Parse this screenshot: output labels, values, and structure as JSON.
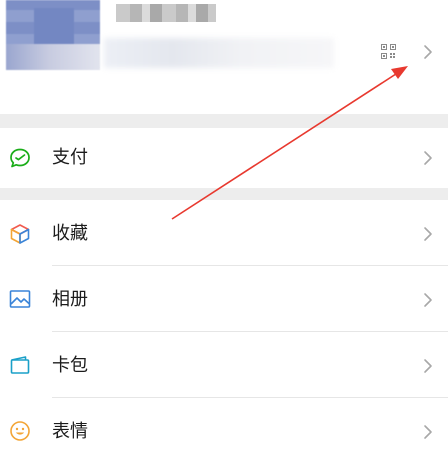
{
  "menu": {
    "pay_label": "支付",
    "favorites_label": "收藏",
    "album_label": "相册",
    "cards_label": "卡包",
    "stickers_label": "表情"
  },
  "colors": {
    "pay_icon": "#1aad19",
    "album_icon": "#3a84d8",
    "cards_icon": "#1aa0c8",
    "stickers_icon": "#f3a536",
    "annotation_arrow": "#e8392f",
    "section_gap": "#ededed"
  },
  "icons": {
    "qr": "qr-code-icon",
    "chevron": "chevron-right-icon",
    "pay": "wallet-icon",
    "favorites": "cube-icon",
    "album": "picture-icon",
    "cards": "card-pack-icon",
    "stickers": "smiley-icon"
  }
}
